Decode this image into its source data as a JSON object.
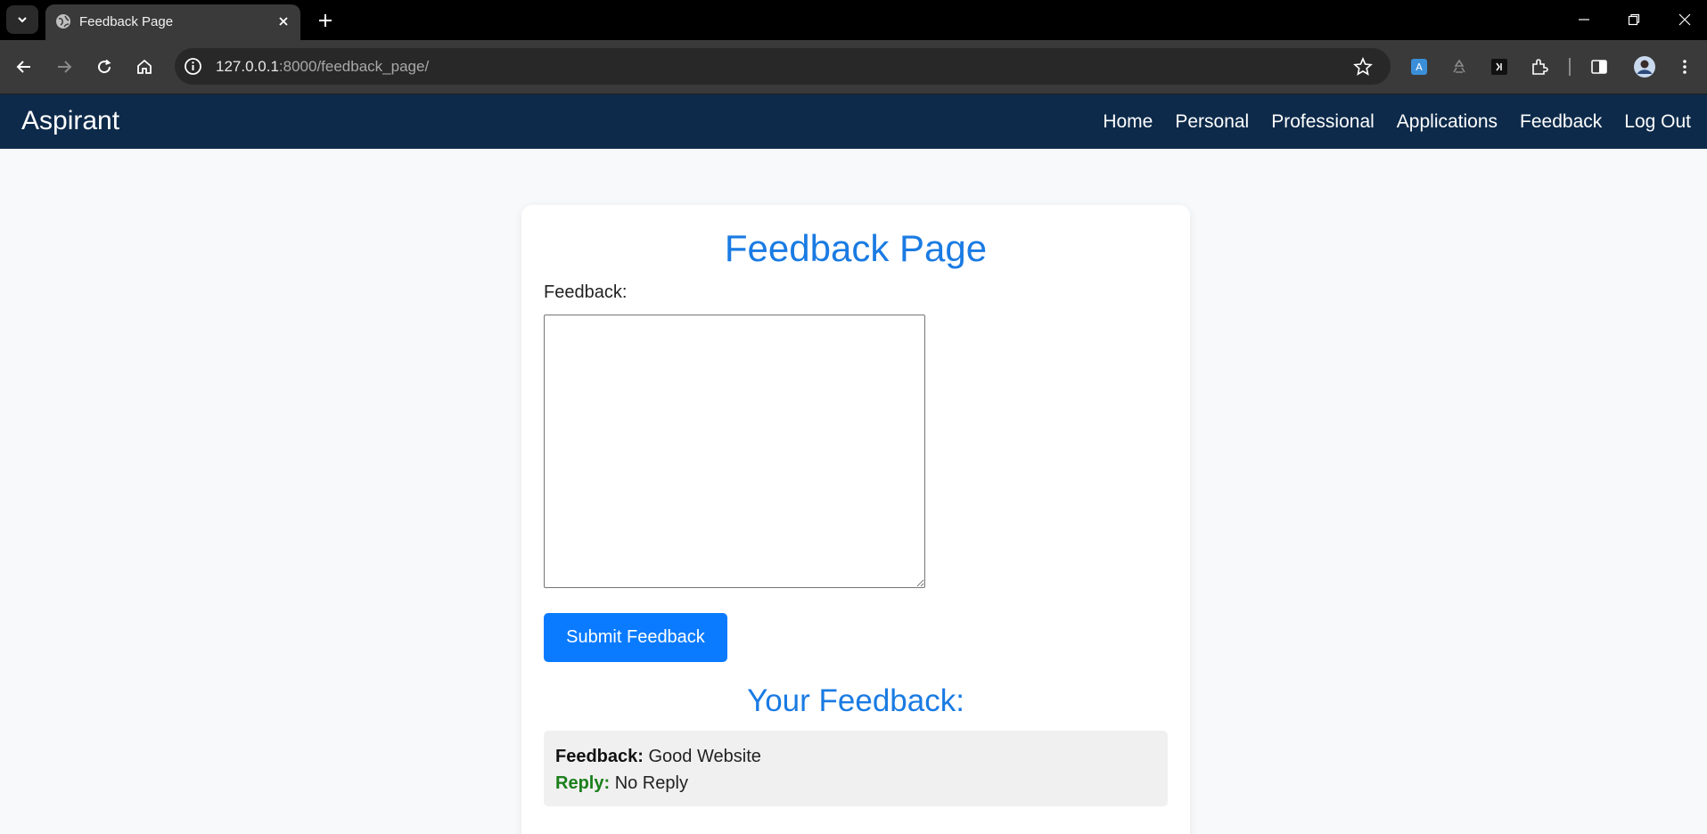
{
  "browser": {
    "tab_title": "Feedback Page",
    "url_host": "127.0.0.1",
    "url_path": ":8000/feedback_page/"
  },
  "navbar": {
    "brand": "Aspirant",
    "links": [
      "Home",
      "Personal",
      "Professional",
      "Applications",
      "Feedback",
      "Log Out"
    ]
  },
  "page": {
    "title": "Feedback Page",
    "feedback_label": "Feedback:",
    "feedback_value": "",
    "submit_label": "Submit Feedback",
    "your_feedback_heading": "Your Feedback:",
    "feedback_items": [
      {
        "feedback_key": "Feedback:",
        "feedback_text": "Good Website",
        "reply_key": "Reply:",
        "reply_text": "No Reply"
      }
    ]
  },
  "colors": {
    "navbar_bg": "#0d2a4a",
    "accent": "#1a7be3",
    "button": "#0a7bff",
    "reply": "#1a7f1a"
  }
}
